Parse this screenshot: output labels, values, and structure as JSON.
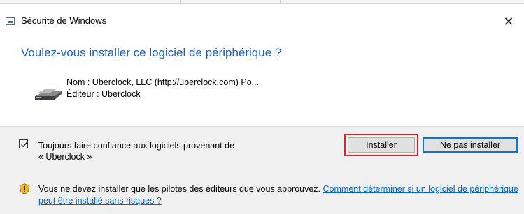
{
  "window": {
    "title": "Sécurité de Windows",
    "close_glyph": "✕"
  },
  "heading": "Voulez-vous installer ce logiciel de périphérique ?",
  "device": {
    "icon": "device-driver-icon",
    "name_line": "Nom : Uberclock, LLC (http://uberclock.com) Po...",
    "publisher_line": "Éditeur : Uberclock"
  },
  "trust": {
    "checked": true,
    "label_line1": "Toujours faire confiance aux logiciels provenant de",
    "label_line2": "« Uberclock »"
  },
  "buttons": {
    "install": "Installer",
    "dont_install": "Ne pas installer"
  },
  "warning": {
    "icon": "shield-warning-icon",
    "text": "Vous ne devez installer que les pilotes des éditeurs que vous approuvez. ",
    "link": "Comment déterminer si un logiciel de périphérique peut être installé sans risques ?"
  },
  "colors": {
    "heading": "#1c5fb8",
    "link": "#0066cc",
    "highlight": "#d9202f",
    "default_button_border": "#0078d7",
    "panel_bg": "#f0f0f0"
  }
}
